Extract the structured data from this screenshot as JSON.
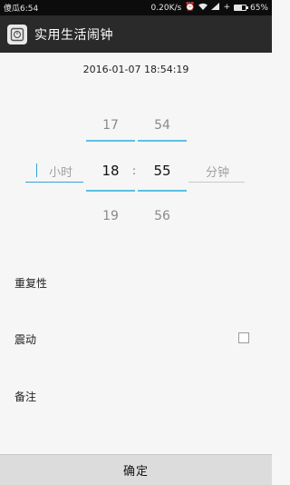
{
  "status_bar": {
    "carrier_time": "傻瓜6:54",
    "speed": "0.20K/s",
    "battery_text": "65%",
    "battery_level": 0.65
  },
  "app_bar": {
    "title": "实用生活闹钟",
    "icon": "alarm-app-icon"
  },
  "datetime": "2016-01-07 18:54:19",
  "picker": {
    "hour": {
      "prev": "17",
      "current": "18",
      "next": "19"
    },
    "minute": {
      "prev": "54",
      "current": "55",
      "next": "56"
    },
    "separator": ":",
    "hour_label": "小时",
    "minute_label": "分钟"
  },
  "options": {
    "repeat_label": "重复性",
    "vibrate_label": "震动",
    "vibrate_checked": false,
    "note_label": "备注"
  },
  "confirm_label": "确定",
  "colors": {
    "accent": "#5cc1e3",
    "action_bar": "#2a2a2a",
    "status_bar": "#0c0c0c"
  }
}
